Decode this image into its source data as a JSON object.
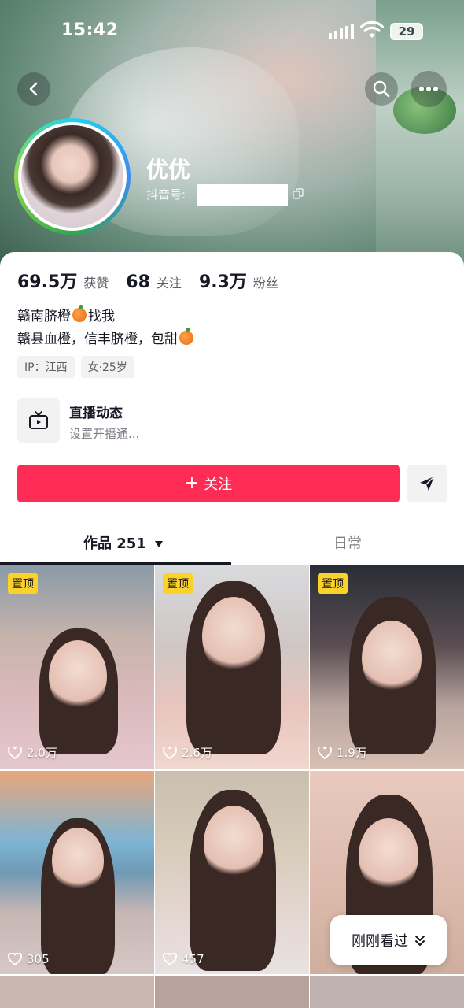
{
  "status_bar": {
    "time": "15:42",
    "battery": "29"
  },
  "profile": {
    "name": "优优",
    "douyin_id_label": "抖音号:"
  },
  "stats": [
    {
      "value": "69.5万",
      "label": "获赞"
    },
    {
      "value": "68",
      "label": "关注"
    },
    {
      "value": "9.3万",
      "label": "粉丝"
    }
  ],
  "bio": {
    "line1_a": "赣南脐橙",
    "line1_b": "找我",
    "line2": "赣县血橙，信丰脐橙，包甜"
  },
  "tags": [
    "IP：江西",
    "女·25岁"
  ],
  "live": {
    "title": "直播动态",
    "subtitle": "设置开播通..."
  },
  "actions": {
    "follow": "关注"
  },
  "tabs": {
    "works": "作品 251",
    "daily": "日常"
  },
  "videos": [
    {
      "pinned": true,
      "pin_label": "置顶",
      "likes": "2.0万"
    },
    {
      "pinned": true,
      "pin_label": "置顶",
      "likes": "2.6万"
    },
    {
      "pinned": true,
      "pin_label": "置顶",
      "likes": "1.9万"
    },
    {
      "pinned": false,
      "likes": "305"
    },
    {
      "pinned": false,
      "likes": "457"
    },
    {
      "pinned": false,
      "likes": ""
    }
  ],
  "recent": {
    "label": "刚刚看过"
  },
  "colors": {
    "accent": "#fe2c55",
    "pin": "#fbd12c"
  }
}
